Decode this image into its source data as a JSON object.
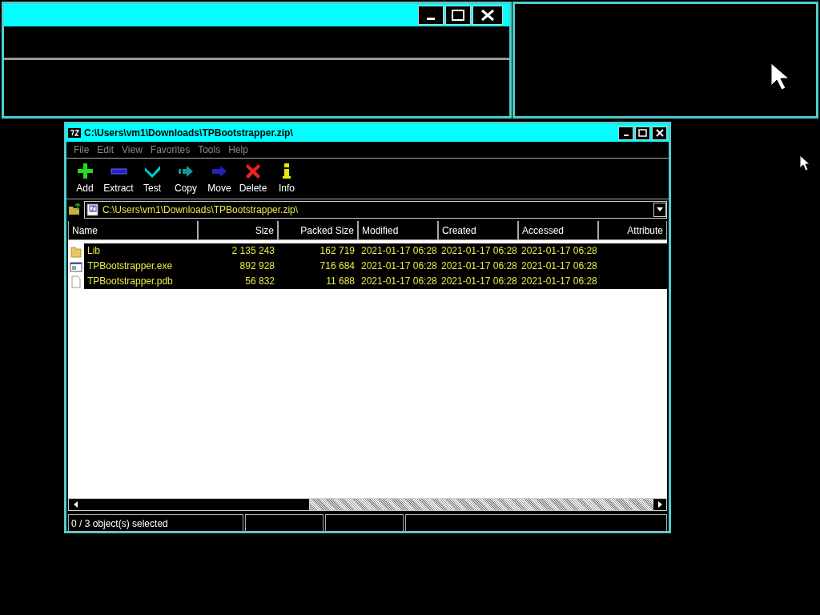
{
  "window": {
    "title": "C:\\Users\\vm1\\Downloads\\TPBootstrapper.zip\\"
  },
  "menu": [
    {
      "label": "File"
    },
    {
      "label": "Edit"
    },
    {
      "label": "View"
    },
    {
      "label": "Favorites"
    },
    {
      "label": "Tools"
    },
    {
      "label": "Help"
    }
  ],
  "toolbar": [
    {
      "label": "Add",
      "kind": "add"
    },
    {
      "label": "Extract",
      "kind": "extract"
    },
    {
      "label": "Test",
      "kind": "test"
    },
    {
      "label": "Copy",
      "kind": "copy"
    },
    {
      "label": "Move",
      "kind": "move"
    },
    {
      "label": "Delete",
      "kind": "delete"
    },
    {
      "label": "Info",
      "kind": "info"
    }
  ],
  "address": {
    "value": "C:\\Users\\vm1\\Downloads\\TPBootstrapper.zip\\"
  },
  "table": {
    "columns": [
      {
        "label": "Name"
      },
      {
        "label": "Size"
      },
      {
        "label": "Packed Size"
      },
      {
        "label": "Modified"
      },
      {
        "label": "Created"
      },
      {
        "label": "Accessed"
      },
      {
        "label": "Attribute"
      }
    ],
    "rows": [
      {
        "kind": "folder",
        "cells": [
          "Lib",
          "2 135 243",
          "162 719",
          "2021-01-17 06:28",
          "2021-01-17 06:28",
          "2021-01-17 06:28"
        ]
      },
      {
        "kind": "exe",
        "cells": [
          "TPBootstrapper.exe",
          "892 928",
          "716 684",
          "2021-01-17 06:28",
          "2021-01-17 06:28",
          "2021-01-17 06:28"
        ]
      },
      {
        "kind": "file",
        "cells": [
          "TPBootstrapper.pdb",
          "56 832",
          "11 688",
          "2021-01-17 06:28",
          "2021-01-17 06:28",
          "2021-01-17 06:28"
        ]
      }
    ]
  },
  "status_bar": {
    "text": "0 / 3 object(s) selected"
  }
}
